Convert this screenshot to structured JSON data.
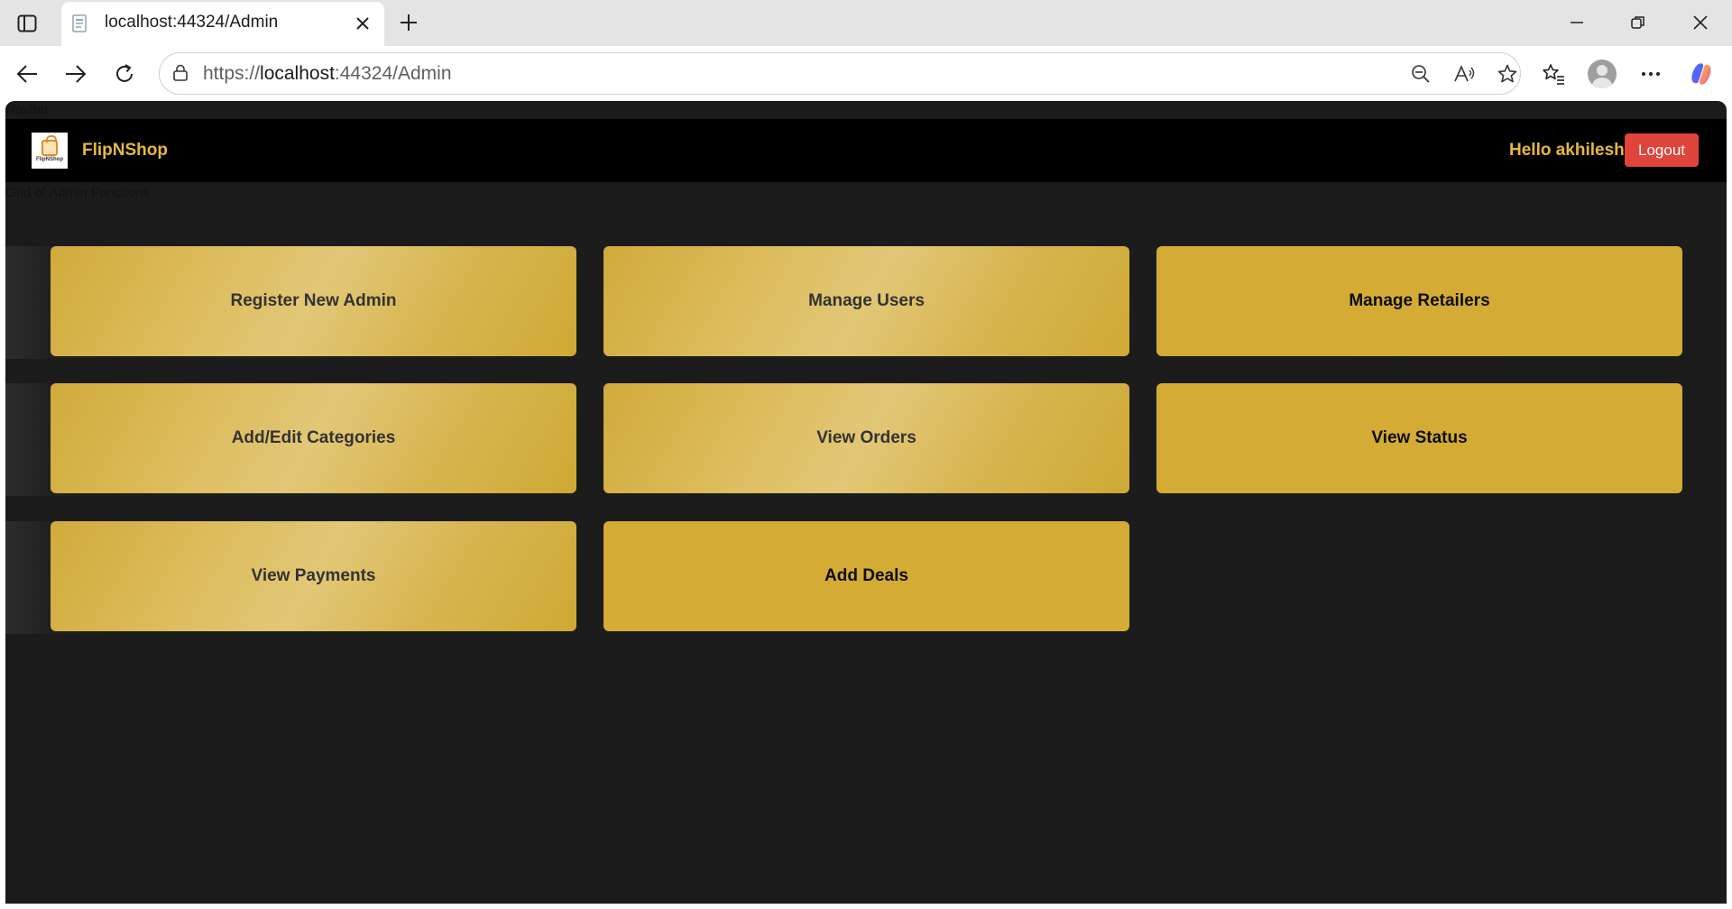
{
  "browser": {
    "tab_title": "localhost:44324/Admin",
    "url_scheme": "https://",
    "url_host": "localhost",
    "url_rest": ":44324/Admin",
    "icons": {
      "sidebar": "sidebar-toggle-icon",
      "favicon": "page-icon",
      "close": "close-icon",
      "new_tab": "plus-icon",
      "minimize": "minimize-icon",
      "restore": "restore-icon",
      "close_window": "close-icon",
      "back": "back-arrow-icon",
      "forward": "forward-arrow-icon",
      "refresh": "refresh-icon",
      "site_info": "lock-icon",
      "zoom": "zoom-out-icon",
      "read_aloud": "read-aloud-icon",
      "favorite": "star-icon",
      "favorites": "favorites-icon",
      "profile": "avatar",
      "more": "more-icon",
      "copilot": "copilot-icon"
    }
  },
  "page": {
    "navbar_label": "Navbar",
    "grid_label": "Grid of Admin Functions",
    "brand_name": "FlipNShop",
    "logo_text": "FlipNShop",
    "greeting": "Hello akhilesh",
    "logout_label": "Logout",
    "functions": [
      {
        "label": "Register New Admin"
      },
      {
        "label": "Manage Users"
      },
      {
        "label": "Manage Retailers"
      },
      {
        "label": "Add/Edit Categories"
      },
      {
        "label": "View Orders"
      },
      {
        "label": "View Status"
      },
      {
        "label": "View Payments"
      },
      {
        "label": "Add Deals"
      }
    ]
  },
  "colors": {
    "page_background": "#1b1b1b",
    "navbar_background": "#000000",
    "accent_gold": "#e5b93c",
    "card_gold": "#d4ac35",
    "logout_red": "#e0443a"
  }
}
